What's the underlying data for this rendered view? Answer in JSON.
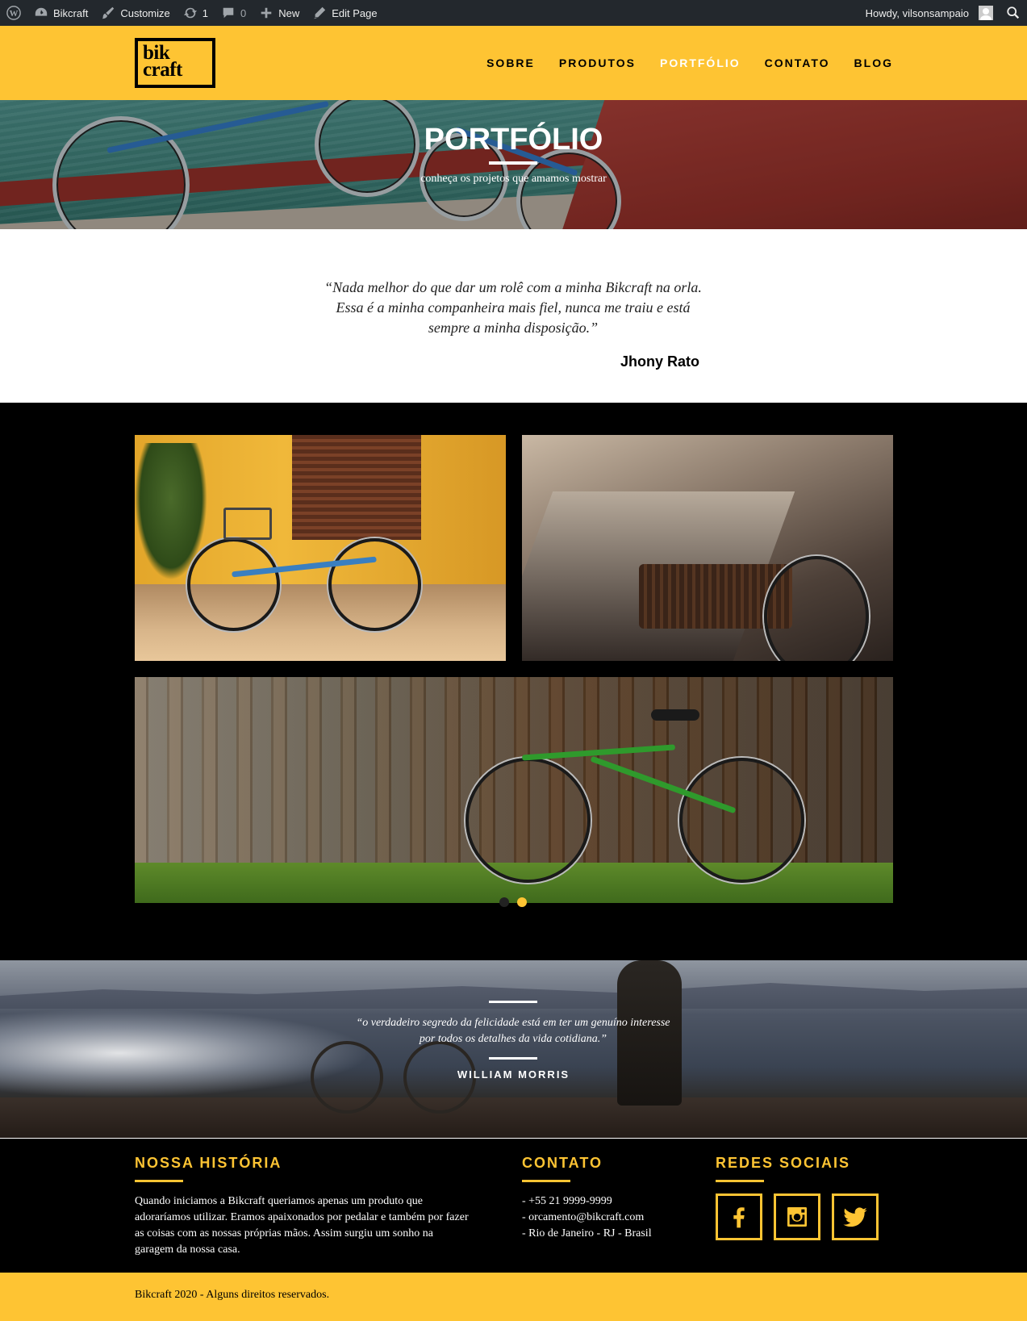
{
  "admin_bar": {
    "site_name": "Bikcraft",
    "customize": "Customize",
    "updates_count": "1",
    "comments_count": "0",
    "new_label": "New",
    "edit_page": "Edit Page",
    "howdy": "Howdy, vilsonsampaio"
  },
  "header": {
    "logo_line1": "bik",
    "logo_line2": "craft",
    "nav": [
      {
        "label": "SOBRE"
      },
      {
        "label": "PRODUTOS"
      },
      {
        "label": "PORTFÓLIO",
        "active": true
      },
      {
        "label": "CONTATO"
      },
      {
        "label": "BLOG"
      }
    ]
  },
  "hero": {
    "title": "PORTFÓLIO",
    "subtitle": "conheça os projetos que amamos mostrar"
  },
  "testimonial": {
    "quote": "“Nada melhor do que dar um rolê com a minha Bikcraft na orla. Essa é a minha companheira mais fiel, nunca me traiu e está sempre a minha disposição.”",
    "author": "Jhony Rato"
  },
  "slider": {
    "dot_count": 2,
    "active_index": 1
  },
  "quote_banner": {
    "quote": "“o verdadeiro segredo da felicidade está em ter um genuíno interesse por todos os detalhes da vida cotidiana.”",
    "author": "WILLIAM MORRIS"
  },
  "footer": {
    "history_title": "NOSSA HISTÓRIA",
    "history_text": "Quando iniciamos a Bikcraft queriamos apenas um produto que adoraríamos utilizar. Eramos apaixonados por pedalar e também por fazer as coisas com as nossas próprias mãos. Assim surgiu um sonho na garagem da nossa casa.",
    "contact_title": "CONTATO",
    "contact_phone": "- +55 21 9999-9999",
    "contact_email": "- orcamento@bikcraft.com",
    "contact_location": "- Rio de Janeiro - RJ - Brasil",
    "social_title": "REDES SOCIAIS",
    "social_icons": [
      "facebook-icon",
      "instagram-icon",
      "twitter-icon"
    ]
  },
  "copyright": "Bikcraft 2020 - Alguns direitos reservados.",
  "colors": {
    "brand_yellow": "#fec433",
    "admin_bar": "#23282d",
    "black": "#000000"
  }
}
